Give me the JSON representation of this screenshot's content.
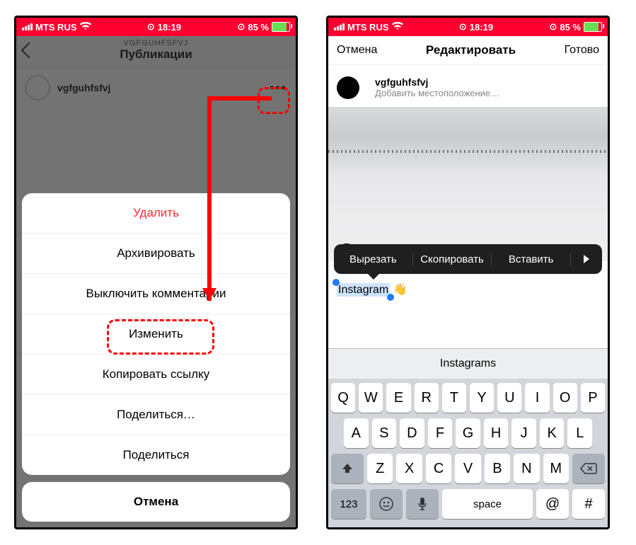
{
  "status": {
    "carrier": "MTS RUS",
    "time": "18:19",
    "alarm": "⏰",
    "battery_pct": "85 %"
  },
  "left": {
    "header_sub": "VGFGUHFSFVJ",
    "header_title": "Публикации",
    "username": "vgfguhfsfvj",
    "menu": {
      "delete": "Удалить",
      "archive": "Архивировать",
      "comments_off": "Выключить комментарии",
      "edit": "Изменить",
      "copy_link": "Копировать ссылку",
      "share_ellipsis": "Поделиться…",
      "share": "Поделиться",
      "cancel": "Отмена"
    }
  },
  "right": {
    "cancel": "Отмена",
    "title": "Редактировать",
    "done": "Готово",
    "username": "vgfguhfsfvj",
    "add_location": "Добавить местоположение…",
    "edit_menu": {
      "cut": "Вырезать",
      "copy": "Скопировать",
      "paste": "Вставить"
    },
    "caption_selected": "Instagram",
    "caption_emoji": "👋",
    "suggestion": "Instagrams",
    "keyboard": {
      "row1": [
        "Q",
        "W",
        "E",
        "R",
        "T",
        "Y",
        "U",
        "I",
        "O",
        "P"
      ],
      "row2": [
        "A",
        "S",
        "D",
        "F",
        "G",
        "H",
        "J",
        "K",
        "L"
      ],
      "row3": [
        "Z",
        "X",
        "C",
        "V",
        "B",
        "N",
        "M"
      ],
      "numkey": "123",
      "space": "space",
      "at": "@",
      "hash": "#"
    }
  }
}
